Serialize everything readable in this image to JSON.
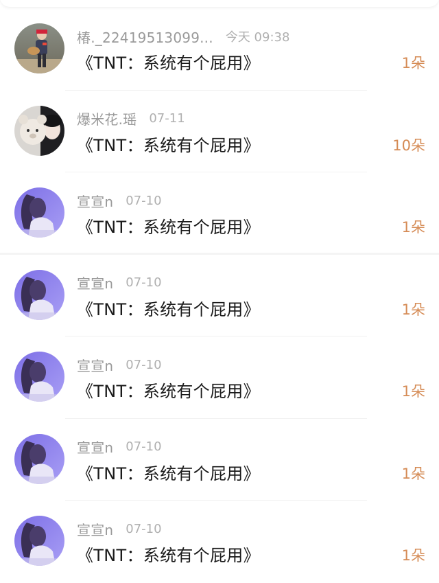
{
  "colors": {
    "name": "#9a9a9a",
    "time": "#b0b0b0",
    "message": "#1a1a1a",
    "count": "#d58b55"
  },
  "entries": [
    {
      "avatar": "avatar-girl-guitar",
      "name": "椿._22419513099...",
      "time": "今天 09:38",
      "message": "《TNT：系统有个屁用》",
      "count": "1朵"
    },
    {
      "avatar": "avatar-teddy-bear",
      "name": "爆米花.瑶",
      "time": "07-11",
      "message": "《TNT：系统有个屁用》",
      "count": "10朵"
    },
    {
      "avatar": "avatar-purple-girl",
      "name": "宣宣n",
      "time": "07-10",
      "message": "《TNT：系统有个屁用》",
      "count": "1朵"
    },
    {
      "avatar": "avatar-purple-girl",
      "name": "宣宣n",
      "time": "07-10",
      "message": "《TNT：系统有个屁用》",
      "count": "1朵"
    },
    {
      "avatar": "avatar-purple-girl",
      "name": "宣宣n",
      "time": "07-10",
      "message": "《TNT：系统有个屁用》",
      "count": "1朵"
    },
    {
      "avatar": "avatar-purple-girl",
      "name": "宣宣n",
      "time": "07-10",
      "message": "《TNT：系统有个屁用》",
      "count": "1朵"
    },
    {
      "avatar": "avatar-purple-girl",
      "name": "宣宣n",
      "time": "07-10",
      "message": "《TNT：系统有个屁用》",
      "count": "1朵"
    }
  ]
}
